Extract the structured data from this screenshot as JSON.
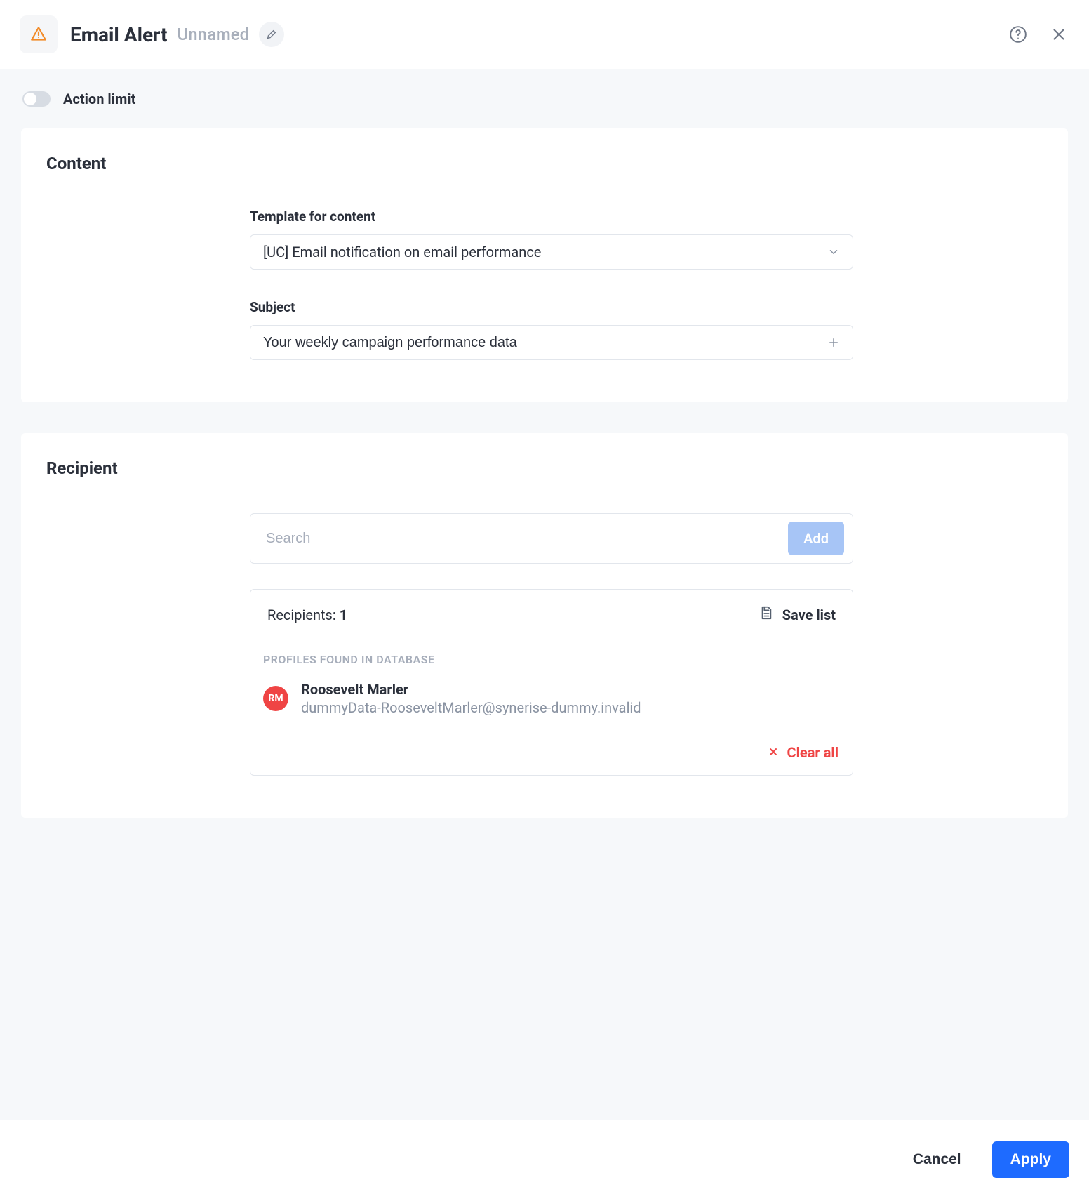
{
  "header": {
    "title": "Email Alert",
    "subtitle": "Unnamed"
  },
  "action_limit": {
    "label": "Action limit",
    "enabled": false
  },
  "content": {
    "heading": "Content",
    "template_label": "Template for content",
    "template_value": "[UC] Email notification on email performance",
    "subject_label": "Subject",
    "subject_value": "Your weekly campaign performance data"
  },
  "recipient": {
    "heading": "Recipient",
    "search_placeholder": "Search",
    "add_label": "Add",
    "count_label": "Recipients:",
    "count_value": "1",
    "save_list_label": "Save list",
    "profiles_header": "PROFILES FOUND IN DATABASE",
    "profile": {
      "initials": "RM",
      "name": "Roosevelt Marler",
      "email": "dummyData-RooseveltMarler@synerise-dummy.invalid"
    },
    "clear_all_label": "Clear all"
  },
  "footer": {
    "cancel": "Cancel",
    "apply": "Apply"
  }
}
